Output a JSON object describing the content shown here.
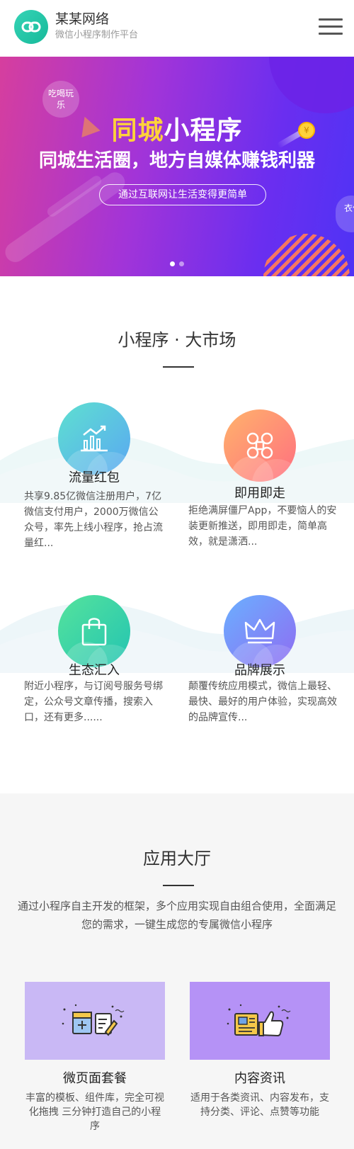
{
  "header": {
    "brand_name": "某某网络",
    "brand_sub": "微信小程序制作平台",
    "logo_icon": "link-icon",
    "menu_icon": "hamburger-menu-icon"
  },
  "banner": {
    "bubble_left": "吃喝玩乐",
    "bubble_right": "衣住",
    "title_highlight": "同城",
    "title_rest": "小程序",
    "subtitle": "同城生活圈，地方自媒体赚钱利器",
    "pill_text": "通过互联网让生活变得更简单",
    "slide_count": 2,
    "active_slide": 1,
    "colors": {
      "start": "#d63e9e",
      "end": "#4f33f5",
      "highlight": "#ffd23a"
    }
  },
  "market": {
    "title": "小程序 · 大市场",
    "features": [
      {
        "title": "流量红包",
        "desc": "共享9.85亿微信注册用户，7亿微信支付用户，2000万微信公众号，率先上线小程序，抢占流量红...",
        "icon": "chart-growth-icon",
        "colors": [
          "#5ee0d0",
          "#5aa8f2"
        ]
      },
      {
        "title": "即用即走",
        "desc": "拒绝满屏僵尸App，不要恼人的安装更新推送，即用即走，简单高效，就是潇洒...",
        "icon": "command-key-icon",
        "colors": [
          "#ffb36b",
          "#ff6f80"
        ]
      },
      {
        "title": "生态汇入",
        "desc": "附近小程序，与订阅号服务号绑定，公众号文章传播，搜索入口，还有更多......",
        "icon": "shopping-bag-icon",
        "colors": [
          "#55e39c",
          "#23c4b2"
        ]
      },
      {
        "title": "品牌展示",
        "desc": "颠覆传统应用模式，微信上最轻、最快、最好的用户体验，实现高效的品牌宣传...",
        "icon": "crown-icon",
        "colors": [
          "#6ab0ff",
          "#8f6cf2"
        ]
      }
    ]
  },
  "hall": {
    "title": "应用大厅",
    "desc": "通过小程序自主开发的框架，多个应用实现自由组合使用，全面满足您的需求，一键生成您的专属微信小程序",
    "apps": [
      {
        "title": "微页面套餐",
        "desc": "丰富的模板、组件库，完全可视化拖拽 三分钟打造自己的小程序",
        "icon": "page-edit-icon",
        "color": "#c9b8f5"
      },
      {
        "title": "内容资讯",
        "desc": "适用于各类资讯、内容发布，支持分类、评论、点赞等功能",
        "icon": "news-thumbs-up-icon",
        "color": "#b592f6"
      }
    ]
  }
}
